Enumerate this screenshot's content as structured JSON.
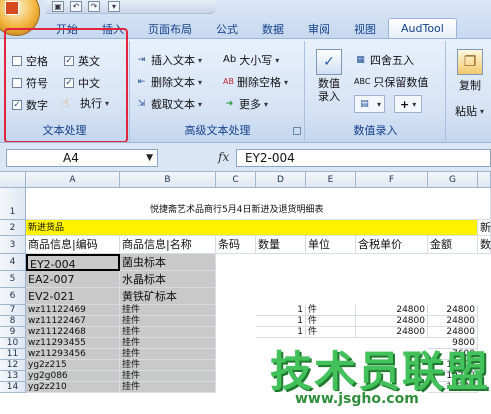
{
  "quick_access": {
    "save": "▣",
    "undo": "↶",
    "redo": "↷",
    "dropdown": "▾"
  },
  "tabs": [
    {
      "label": "开始"
    },
    {
      "label": "插入"
    },
    {
      "label": "页面布局"
    },
    {
      "label": "公式"
    },
    {
      "label": "数据"
    },
    {
      "label": "审阅"
    },
    {
      "label": "视图"
    },
    {
      "label": "AudTool"
    }
  ],
  "ribbon": {
    "text_processing": {
      "label": "文本处理",
      "checkboxes": [
        {
          "label": "空格",
          "checked": false
        },
        {
          "label": "英文",
          "checked": true
        },
        {
          "label": "符号",
          "checked": false
        },
        {
          "label": "中文",
          "checked": true
        },
        {
          "label": "数字",
          "checked": true
        }
      ],
      "execute": "执行"
    },
    "advanced": {
      "label": "高级文本处理",
      "insert_text": "插入文本",
      "delete_text": "删除文本",
      "extract_text": "截取文本",
      "case": "大小写",
      "delete_spaces": "删除空格",
      "more": "更多",
      "case_icon": "Ab",
      "delete_spaces_icon": "AB"
    },
    "number_entry": {
      "label": "数值录入",
      "entry_button": "数值\n录入",
      "round": "四舍五入",
      "keep_value": "只保留数值",
      "keep_icon": "ABC",
      "plus": "+"
    },
    "clipboard": {
      "copy": "复制",
      "paste": "粘贴"
    }
  },
  "formula_bar": {
    "name_box": "A4",
    "fx": "fx",
    "value": "EY2-004"
  },
  "columns": [
    "A",
    "B",
    "C",
    "D",
    "E",
    "F",
    "G"
  ],
  "rows": [
    "1",
    "2",
    "3",
    "4",
    "5",
    "6",
    "7",
    "8",
    "9",
    "10",
    "11",
    "12",
    "13",
    "14"
  ],
  "sheet": {
    "title": "悦捷斋艺术品商行5月4日新进及退货明细表",
    "section": "新进货品",
    "section_right": "新",
    "headers": [
      "商品信息|编码",
      "商品信息|名称",
      "条码",
      "数量",
      "单位",
      "含税单价",
      "金额"
    ],
    "header_right": "数",
    "data": [
      {
        "a": "EY2-004",
        "b": "菌虫标本",
        "d": "",
        "e": "",
        "f": "",
        "g": ""
      },
      {
        "a": "EA2-007",
        "b": "水晶标本",
        "d": "",
        "e": "",
        "f": "",
        "g": ""
      },
      {
        "a": "EV2-021",
        "b": "黄铁矿标本",
        "d": "",
        "e": "",
        "f": "",
        "g": ""
      },
      {
        "a": "wz11122469",
        "b": "挂件",
        "d": "1",
        "e": "件",
        "f": "24800",
        "g": "24800"
      },
      {
        "a": "wz11122467",
        "b": "挂件",
        "d": "1",
        "e": "件",
        "f": "24800",
        "g": "24800"
      },
      {
        "a": "wz11122468",
        "b": "挂件",
        "d": "1",
        "e": "件",
        "f": "24800",
        "g": "24800"
      },
      {
        "a": "wz11293455",
        "b": "挂件",
        "d": "",
        "e": "",
        "f": "",
        "g": "9800"
      },
      {
        "a": "wz11293456",
        "b": "挂件",
        "d": "",
        "e": "",
        "f": "",
        "g": "7600"
      },
      {
        "a": "yg2z215",
        "b": "挂件",
        "d": "",
        "e": "",
        "f": "",
        "g": "12000"
      },
      {
        "a": "yg2g086",
        "b": "挂件",
        "d": "",
        "e": "",
        "f": "",
        "g": "19200"
      },
      {
        "a": "yg2z210",
        "b": "挂件",
        "d": "",
        "e": "",
        "f": "",
        "g": "19200"
      }
    ]
  },
  "watermark": {
    "text": "技术员联盟",
    "url": "www.jsgho.com"
  }
}
